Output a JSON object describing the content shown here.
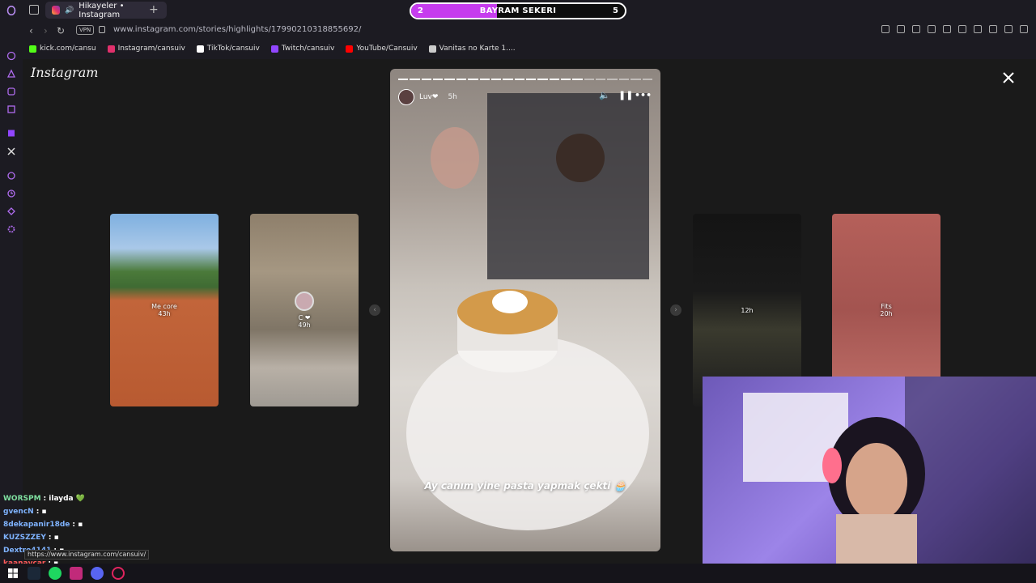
{
  "browser": {
    "tab_title": "Hikayeler • Instagram",
    "new_tab": "+",
    "url": "www.instagram.com/stories/highlights/17990210318855692/",
    "vpn_label": "VPN"
  },
  "goal_bar": {
    "title": "BAYRAM SEKERI",
    "current": "2",
    "target": "5",
    "progress": 0.4,
    "fill_color": "#c63cee"
  },
  "bookmarks": [
    {
      "label": "kick.com/cansu",
      "icon": "kick-icon",
      "color": "#53fc18"
    },
    {
      "label": "Instagram/cansuiv",
      "icon": "instagram-icon",
      "color": "#e1306c"
    },
    {
      "label": "TikTok/cansuiv",
      "icon": "tiktok-icon",
      "color": "#ffffff"
    },
    {
      "label": "Twitch/cansuiv",
      "icon": "twitch-icon",
      "color": "#9146ff"
    },
    {
      "label": "YouTube/Cansuiv",
      "icon": "youtube-icon",
      "color": "#ff0000"
    },
    {
      "label": "Vanitas no Karte 1....",
      "icon": "bookmark-icon",
      "color": "#cccccc"
    }
  ],
  "instagram": {
    "logo": "Instagram",
    "left_stories": [
      {
        "label": "Me core",
        "time": "43h"
      },
      {
        "label": "C ❤",
        "time": "49h"
      }
    ],
    "right_stories": [
      {
        "label": "",
        "time": "12h"
      },
      {
        "label": "Fits",
        "time": "20h"
      }
    ],
    "main_story": {
      "user": "Luv❤",
      "time": "5h",
      "caption": "Ay canım yine pasta yapmak çekti 🧁",
      "segments_total": 22,
      "segments_done": 16
    }
  },
  "chat": [
    {
      "user": "WORSPM",
      "msg": ": ilayda 💚",
      "color": "#7fe0a0"
    },
    {
      "user": "gvencN",
      "msg": ": ▪",
      "color": "#7fb3ff"
    },
    {
      "user": "8dekapanir18de",
      "msg": ": ▪",
      "color": "#7fb3ff"
    },
    {
      "user": "KUZSZZEY",
      "msg": ": ▪",
      "color": "#7fb3ff"
    },
    {
      "user": "Dextro4141",
      "msg": ": ▪",
      "color": "#7fb3ff"
    },
    {
      "user": "kaanavcar",
      "msg": ": ▪",
      "color": "#ff5a5a"
    }
  ],
  "status_url": "https://www.instagram.com/cansuiv/"
}
